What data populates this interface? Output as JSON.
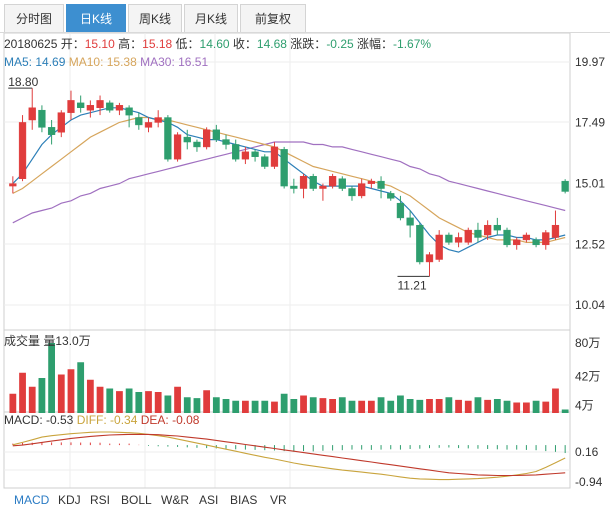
{
  "tabs": [
    {
      "label": "分时图",
      "active": false
    },
    {
      "label": "日K线",
      "active": true
    },
    {
      "label": "周K线",
      "active": false
    },
    {
      "label": "月K线",
      "active": false
    },
    {
      "label": "前复权",
      "active": false
    }
  ],
  "info": {
    "date": "20180625",
    "open_label": "开：",
    "open": "15.10",
    "high_label": "高：",
    "high": "15.18",
    "low_label": "低：",
    "low": "14.60",
    "close_label": "收：",
    "close": "14.68",
    "change_label": "涨跌：",
    "change": "-0.25",
    "pct_label": "涨幅：",
    "pct": "-1.67%"
  },
  "ma": {
    "ma5_label": "MA5: 14.69",
    "ma10_label": "MA10: 15.38",
    "ma30_label": "MA30: 16.51"
  },
  "volume_info": {
    "label": "成交量",
    "value": "量13.0万"
  },
  "macd_info": {
    "macd": "MACD: -0.53",
    "diff": "DIFF: -0.34",
    "dea": "DEA: -0.08"
  },
  "bottom_tabs": [
    "MACD",
    "KDJ",
    "RSI",
    "BOLL",
    "W&R",
    "ASI",
    "BIAS",
    "VR"
  ],
  "colors": {
    "up": "#e03c3c",
    "down": "#2e9e6e",
    "ma5": "#2c7fb8",
    "ma10": "#d6a55c",
    "ma30": "#a070c0",
    "diff": "#c9a43d",
    "dea": "#c0392b",
    "active_tab": "#3d8fd0"
  },
  "chart_data": {
    "type": "candlestick",
    "price_axis": {
      "ticks": [
        "19.97",
        "17.49",
        "15.01",
        "12.52",
        "10.04"
      ],
      "range": [
        10.04,
        19.97
      ]
    },
    "annotations": {
      "max": "18.80",
      "min": "11.21"
    },
    "volume_axis": {
      "ticks": [
        "80万",
        "42万",
        "4万"
      ],
      "range": [
        0,
        80
      ]
    },
    "macd_axis": {
      "ticks": [
        "0.16",
        "-0.94"
      ],
      "range": [
        -1.2,
        0.4
      ]
    },
    "candles": [
      [
        14.9,
        15.0,
        14.6,
        15.3
      ],
      [
        15.2,
        17.5,
        15.1,
        17.8
      ],
      [
        17.6,
        18.1,
        17.2,
        18.9
      ],
      [
        18.0,
        17.3,
        17.1,
        18.2
      ],
      [
        17.3,
        17.0,
        16.6,
        17.6
      ],
      [
        17.1,
        17.9,
        16.9,
        18.0
      ],
      [
        17.9,
        18.4,
        17.6,
        18.8
      ],
      [
        18.3,
        18.1,
        17.9,
        18.6
      ],
      [
        18.0,
        18.2,
        17.7,
        18.4
      ],
      [
        18.1,
        18.4,
        17.8,
        18.6
      ],
      [
        18.3,
        18.0,
        17.9,
        18.4
      ],
      [
        18.0,
        18.2,
        17.8,
        18.3
      ],
      [
        18.1,
        17.8,
        17.3,
        18.2
      ],
      [
        17.7,
        17.4,
        17.2,
        17.9
      ],
      [
        17.3,
        17.5,
        17.1,
        17.7
      ],
      [
        17.5,
        17.7,
        17.3,
        18.0
      ],
      [
        17.7,
        16.0,
        15.9,
        17.8
      ],
      [
        16.0,
        17.0,
        15.9,
        17.1
      ],
      [
        16.9,
        16.7,
        16.4,
        17.2
      ],
      [
        16.7,
        16.5,
        16.3,
        16.8
      ],
      [
        16.5,
        17.2,
        16.4,
        17.3
      ],
      [
        17.2,
        16.8,
        16.7,
        17.4
      ],
      [
        16.8,
        16.6,
        16.4,
        17.0
      ],
      [
        16.6,
        16.0,
        15.9,
        16.8
      ],
      [
        16.0,
        16.3,
        15.8,
        16.5
      ],
      [
        16.3,
        16.1,
        15.9,
        16.4
      ],
      [
        16.1,
        15.7,
        15.6,
        16.2
      ],
      [
        15.7,
        16.5,
        15.6,
        16.7
      ],
      [
        16.4,
        14.9,
        14.8,
        16.5
      ],
      [
        14.9,
        14.8,
        14.6,
        15.2
      ],
      [
        14.8,
        15.3,
        14.4,
        15.4
      ],
      [
        15.3,
        14.8,
        14.7,
        15.4
      ],
      [
        14.8,
        14.9,
        14.3,
        15.0
      ],
      [
        14.9,
        15.3,
        14.8,
        15.4
      ],
      [
        15.2,
        14.8,
        14.7,
        15.3
      ],
      [
        14.8,
        14.5,
        14.3,
        14.9
      ],
      [
        14.5,
        15.0,
        14.4,
        15.2
      ],
      [
        15.0,
        15.1,
        14.8,
        15.2
      ],
      [
        15.1,
        14.8,
        14.4,
        15.3
      ],
      [
        14.6,
        14.4,
        14.3,
        14.7
      ],
      [
        14.2,
        13.6,
        13.5,
        14.5
      ],
      [
        13.6,
        13.3,
        12.8,
        13.9
      ],
      [
        13.3,
        11.8,
        11.7,
        13.4
      ],
      [
        11.8,
        12.1,
        11.21,
        12.2
      ],
      [
        11.9,
        12.9,
        11.8,
        13.1
      ],
      [
        12.9,
        12.6,
        12.5,
        13.0
      ],
      [
        12.6,
        12.8,
        12.4,
        13.0
      ],
      [
        12.6,
        13.1,
        12.5,
        13.2
      ],
      [
        13.1,
        12.8,
        12.6,
        13.4
      ],
      [
        12.9,
        13.3,
        12.7,
        13.5
      ],
      [
        13.3,
        13.1,
        12.9,
        13.6
      ],
      [
        13.1,
        12.5,
        12.4,
        13.2
      ],
      [
        12.5,
        12.7,
        12.3,
        12.8
      ],
      [
        12.7,
        12.9,
        12.6,
        13.0
      ],
      [
        12.7,
        12.5,
        12.4,
        12.8
      ],
      [
        12.5,
        13.0,
        12.3,
        13.1
      ],
      [
        12.8,
        13.3,
        12.7,
        13.9
      ],
      [
        15.1,
        14.68,
        14.6,
        15.18
      ]
    ],
    "ma5": [
      15.0,
      15.4,
      16.0,
      16.6,
      17.0,
      17.3,
      17.6,
      17.8,
      17.9,
      18.0,
      18.1,
      18.1,
      18.0,
      17.9,
      17.7,
      17.6,
      17.5,
      17.3,
      17.0,
      16.9,
      16.8,
      16.8,
      16.7,
      16.6,
      16.5,
      16.4,
      16.3,
      16.3,
      16.0,
      15.7,
      15.4,
      15.1,
      14.9,
      14.9,
      14.9,
      14.9,
      14.9,
      14.8,
      14.7,
      14.6,
      14.3,
      13.9,
      13.4,
      12.9,
      12.5,
      12.3,
      12.2,
      12.4,
      12.6,
      12.8,
      12.9,
      12.9,
      12.8,
      12.8,
      12.7,
      12.7,
      12.8,
      12.9
    ],
    "ma10": [
      14.6,
      14.8,
      15.1,
      15.4,
      15.7,
      16.0,
      16.3,
      16.6,
      16.9,
      17.1,
      17.3,
      17.5,
      17.6,
      17.7,
      17.7,
      17.6,
      17.6,
      17.5,
      17.4,
      17.3,
      17.2,
      17.1,
      17.0,
      16.9,
      16.8,
      16.7,
      16.6,
      16.5,
      16.3,
      16.1,
      15.9,
      15.7,
      15.6,
      15.5,
      15.4,
      15.3,
      15.2,
      15.1,
      15.0,
      14.9,
      14.7,
      14.5,
      14.2,
      13.9,
      13.6,
      13.4,
      13.2,
      13.0,
      12.9,
      12.8,
      12.7,
      12.7,
      12.7,
      12.6,
      12.6,
      12.6,
      12.7,
      12.8
    ],
    "ma30": [
      13.4,
      13.6,
      13.8,
      13.9,
      14.0,
      14.2,
      14.3,
      14.5,
      14.6,
      14.8,
      14.9,
      15.0,
      15.2,
      15.3,
      15.4,
      15.5,
      15.6,
      15.7,
      15.8,
      15.9,
      16.0,
      16.1,
      16.2,
      16.3,
      16.4,
      16.5,
      16.6,
      16.7,
      16.7,
      16.7,
      16.7,
      16.6,
      16.6,
      16.5,
      16.5,
      16.4,
      16.3,
      16.2,
      16.1,
      16.0,
      15.9,
      15.7,
      15.6,
      15.4,
      15.3,
      15.1,
      15.0,
      14.9,
      14.8,
      14.7,
      14.6,
      14.5,
      14.4,
      14.3,
      14.2,
      14.1,
      14.0,
      13.9
    ],
    "volume": [
      22,
      46,
      30,
      40,
      80,
      44,
      50,
      58,
      38,
      30,
      28,
      25,
      28,
      24,
      25,
      24,
      20,
      30,
      18,
      17,
      26,
      18,
      16,
      14,
      14,
      14,
      14,
      13,
      22,
      16,
      20,
      18,
      17,
      16,
      18,
      14,
      14,
      14,
      18,
      14,
      20,
      16,
      15,
      16,
      16,
      18,
      15,
      14,
      18,
      15,
      16,
      14,
      12,
      12,
      14,
      13,
      28,
      4
    ],
    "macd": [
      0.1,
      0.14,
      0.16,
      0.18,
      0.18,
      0.18,
      0.18,
      0.17,
      0.17,
      0.16,
      0.1,
      0.1,
      0.1,
      0.02,
      -0.05,
      -0.08,
      -0.1,
      -0.12,
      -0.15,
      -0.18,
      -0.2,
      -0.22,
      -0.24,
      -0.28,
      -0.3,
      -0.32,
      -0.34,
      -0.36,
      -0.4,
      -0.44,
      -0.4,
      -0.42,
      -0.38,
      -0.36,
      -0.34,
      -0.3,
      -0.3,
      -0.32,
      -0.3,
      -0.28,
      -0.3,
      -0.26,
      -0.24,
      -0.2,
      -0.18,
      -0.16,
      -0.2,
      -0.22,
      -0.24,
      -0.26,
      -0.28,
      -0.3,
      -0.3,
      -0.32,
      -0.34,
      -0.4,
      -0.45,
      -0.53
    ],
    "diff": [
      0.05,
      0.12,
      0.2,
      0.28,
      0.32,
      0.35,
      0.38,
      0.4,
      0.42,
      0.43,
      0.43,
      0.42,
      0.41,
      0.39,
      0.36,
      0.32,
      0.28,
      0.22,
      0.16,
      0.1,
      0.04,
      -0.02,
      -0.08,
      -0.14,
      -0.2,
      -0.26,
      -0.32,
      -0.37,
      -0.43,
      -0.49,
      -0.54,
      -0.58,
      -0.62,
      -0.66,
      -0.7,
      -0.73,
      -0.76,
      -0.79,
      -0.82,
      -0.86,
      -0.9,
      -0.94,
      -0.96,
      -0.97,
      -0.98,
      -0.98,
      -0.97,
      -0.96,
      -0.95,
      -0.93,
      -0.91,
      -0.88,
      -0.84,
      -0.8,
      -0.74,
      -0.62,
      -0.48,
      -0.34
    ],
    "dea": [
      0.02,
      0.04,
      0.08,
      0.12,
      0.16,
      0.2,
      0.24,
      0.27,
      0.3,
      0.32,
      0.34,
      0.35,
      0.36,
      0.36,
      0.36,
      0.35,
      0.33,
      0.31,
      0.28,
      0.25,
      0.22,
      0.18,
      0.14,
      0.1,
      0.06,
      0.02,
      -0.02,
      -0.06,
      -0.1,
      -0.14,
      -0.18,
      -0.22,
      -0.26,
      -0.3,
      -0.34,
      -0.38,
      -0.42,
      -0.46,
      -0.5,
      -0.54,
      -0.58,
      -0.62,
      -0.66,
      -0.7,
      -0.74,
      -0.78,
      -0.8,
      -0.82,
      -0.84,
      -0.85,
      -0.86,
      -0.86,
      -0.86,
      -0.85,
      -0.84,
      -0.82,
      -0.8,
      -0.78
    ]
  }
}
